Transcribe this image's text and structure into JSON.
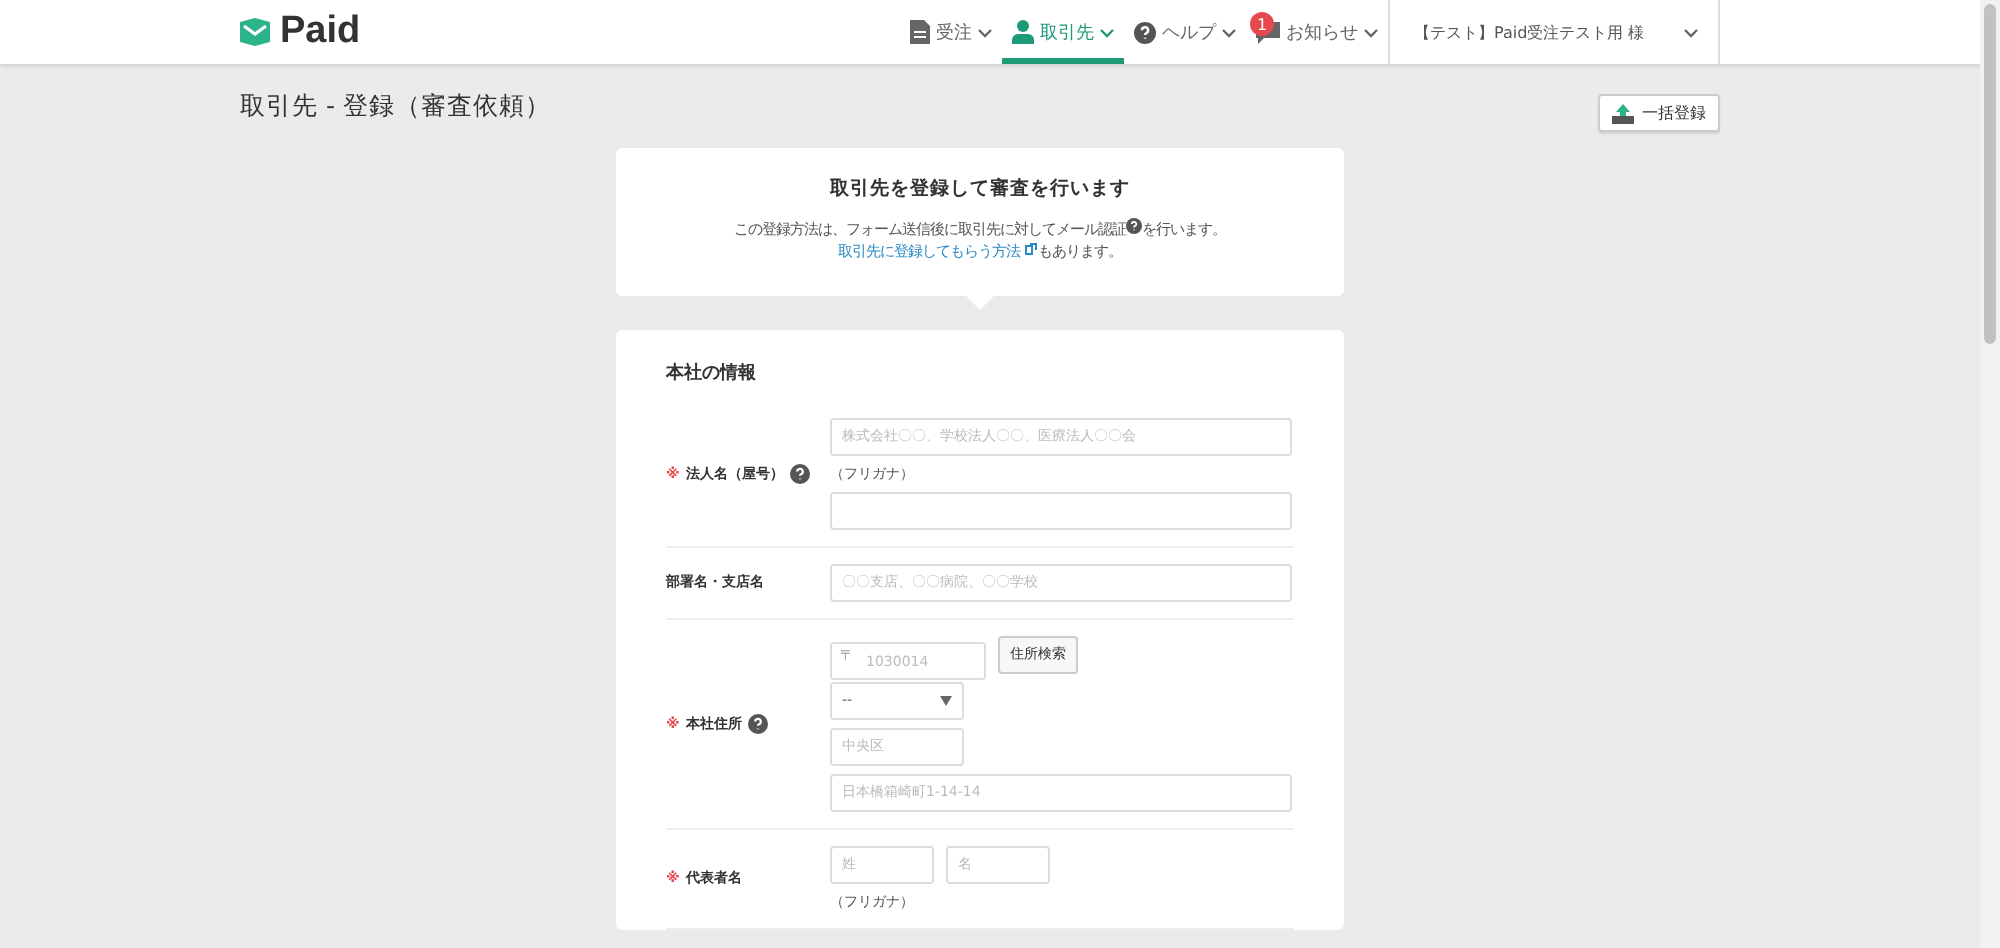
{
  "header": {
    "logo": "Paid",
    "nav": [
      {
        "label": "受注",
        "selected": false
      },
      {
        "label": "取引先",
        "selected": true
      },
      {
        "label": "ヘルプ",
        "selected": false
      },
      {
        "label": "お知らせ",
        "selected": false,
        "badge": "1"
      }
    ],
    "account": "【テスト】Paid受注テスト用 様"
  },
  "page_title": "取引先 - 登録（審査依頼）",
  "bulk_button": "一括登録",
  "notice": {
    "title": "取引先を登録して審査を行います",
    "text_before": "この登録方法は、フォーム送信後に取引先に対してメール認証",
    "text_after": "を行います。",
    "link": "取引先に登録してもらう方法",
    "link_after": "もあります。"
  },
  "form": {
    "section_title": "本社の情報",
    "rows": [
      {
        "label": "法人名（屋号）",
        "mark": "※",
        "help": true,
        "lines": [
          [
            {
              "kind": "wide_input",
              "placeholder": "株式会社〇〇、学校法人〇〇、医療法人〇〇会"
            }
          ],
          [
            {
              "kind": "note",
              "text": "（フリガナ）"
            }
          ],
          [
            {
              "kind": "wide_input"
            }
          ]
        ]
      },
      {
        "label": "部署名・支店名",
        "help": false,
        "lines": [
          [
            {
              "kind": "wide_input",
              "placeholder": "〇〇支店、〇〇病院、〇〇学校"
            }
          ]
        ]
      },
      {
        "label": "本社住所",
        "mark": "※",
        "help": true,
        "lines": [
          [
            {
              "kind": "postal",
              "prefix": "〒",
              "placeholder": "1030014"
            },
            {
              "kind": "button",
              "text": "住所検索"
            }
          ],
          [
            {
              "kind": "select",
              "value": "--"
            }
          ],
          [
            {
              "kind": "short_input",
              "placeholder": "中央区"
            }
          ],
          [
            {
              "kind": "wide_input",
              "placeholder": "日本橋箱崎町1-14-14"
            }
          ]
        ]
      },
      {
        "label": "代表者名",
        "mark": "※",
        "help": false,
        "lines": [
          [
            {
              "kind": "name_input",
              "placeholder": "姓"
            },
            {
              "kind": "name_input",
              "placeholder": "名"
            }
          ],
          [
            {
              "kind": "note",
              "text": "（フリガナ）"
            }
          ]
        ]
      }
    ]
  }
}
